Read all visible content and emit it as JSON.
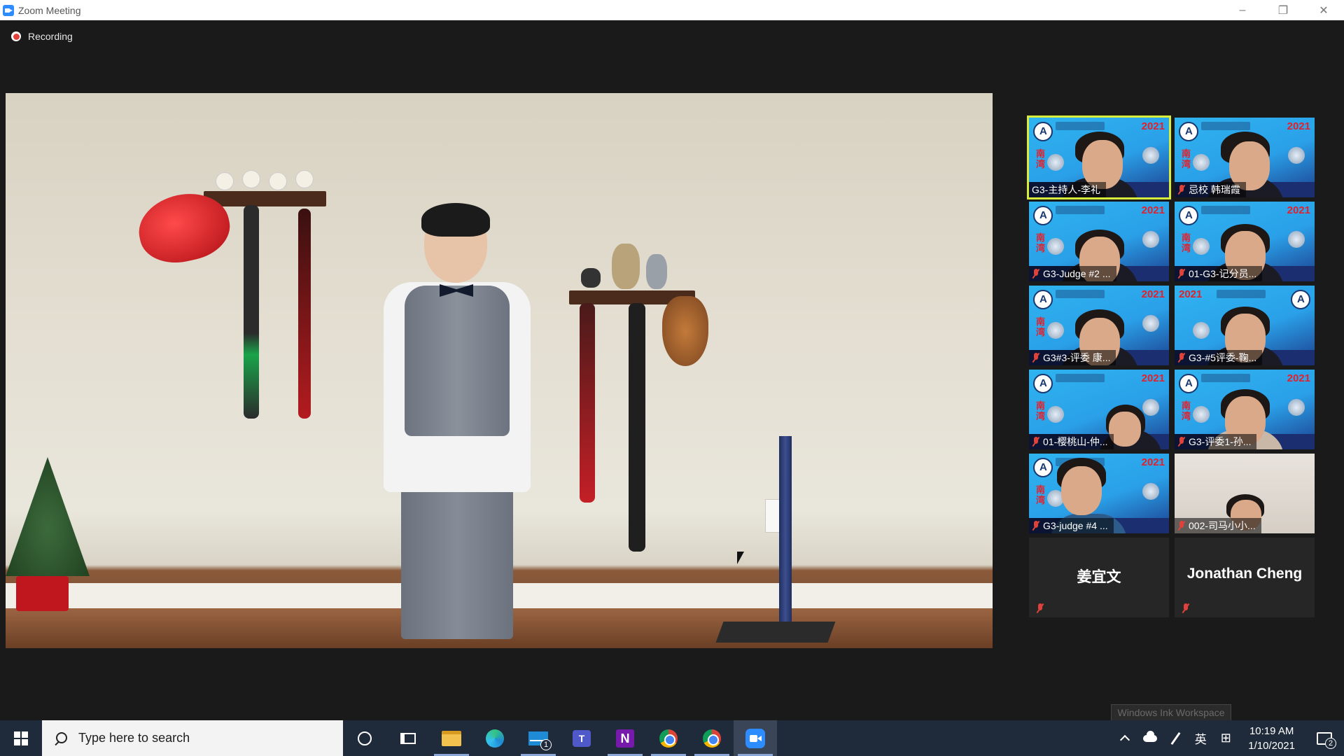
{
  "window": {
    "title": "Zoom Meeting",
    "controls": {
      "minimize": "–",
      "restore": "❐",
      "close": "✕"
    }
  },
  "meeting": {
    "recording_label": "Recording",
    "participants": [
      {
        "name": "G3-主持人-李礼",
        "muted": false,
        "active_speaker": true,
        "video": "avatar"
      },
      {
        "name": "忌校 韩瑞霞",
        "muted": true,
        "active_speaker": false,
        "video": "avatar"
      },
      {
        "name": "G3-Judge #2 ...",
        "muted": true,
        "active_speaker": false,
        "video": "avatar"
      },
      {
        "name": "01-G3-记分员...",
        "muted": true,
        "active_speaker": false,
        "video": "avatar"
      },
      {
        "name": "G3#3-评委 康...",
        "muted": true,
        "active_speaker": false,
        "video": "avatar"
      },
      {
        "name": "G3-#5评委-鞠...",
        "muted": true,
        "active_speaker": false,
        "video": "avatar"
      },
      {
        "name": "01-樱桃山-仲...",
        "muted": true,
        "active_speaker": false,
        "video": "avatar"
      },
      {
        "name": "G3-评委1-孙...",
        "muted": true,
        "active_speaker": false,
        "video": "avatar"
      },
      {
        "name": "G3-judge #4 ...",
        "muted": true,
        "active_speaker": false,
        "video": "avatar"
      },
      {
        "name": "002-司马小小...",
        "muted": true,
        "active_speaker": false,
        "video": "plain"
      },
      {
        "name": "姜宜文",
        "muted": true,
        "active_speaker": false,
        "video": "off"
      },
      {
        "name": "Jonathan Cheng",
        "muted": true,
        "active_speaker": false,
        "video": "off"
      }
    ],
    "tile_overlay": {
      "year": "2021",
      "side_text": "南湾"
    }
  },
  "tooltip": {
    "text": "Windows Ink Workspace"
  },
  "taskbar": {
    "search_placeholder": "Type here to search",
    "mail_badge": "1",
    "onenote_letter": "N",
    "teams_letter": "T",
    "tray": {
      "ime_label": "英",
      "keyboard_glyph": "⊞",
      "time": "10:19 AM",
      "date": "1/10/2021",
      "notification_count": "2"
    }
  },
  "colors": {
    "active_speaker_border": "#d8ec3a",
    "recording_red": "#e0413a",
    "zoom_blue": "#2d8cff",
    "taskbar_bg": "#1f2a3a"
  }
}
